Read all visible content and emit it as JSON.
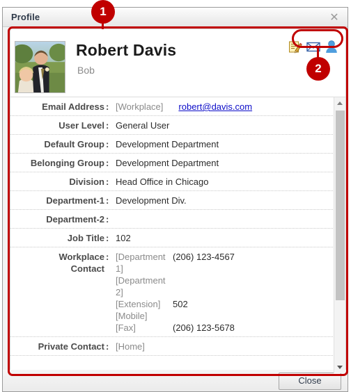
{
  "window": {
    "title": "Profile",
    "close_icon": "close-x-icon"
  },
  "header": {
    "name": "Robert Davis",
    "alias": "Bob",
    "photo_alt": "profile-photo",
    "actions": [
      {
        "name": "edit-profile-icon",
        "title": "Edit"
      },
      {
        "name": "send-mail-icon",
        "title": "Mail"
      },
      {
        "name": "user-icon",
        "title": "User"
      }
    ]
  },
  "details": [
    {
      "label": "Email Address",
      "type": "email",
      "tag": "[Workplace]",
      "value": "robert@davis.com"
    },
    {
      "label": "User Level",
      "type": "text",
      "value": "General User"
    },
    {
      "label": "Default Group",
      "type": "text",
      "value": "Development Department"
    },
    {
      "label": "Belonging Group",
      "type": "text",
      "value": "Development Department"
    },
    {
      "label": "Division",
      "type": "text",
      "value": "Head Office in Chicago"
    },
    {
      "label": "Department-1",
      "type": "text",
      "value": "Development Div."
    },
    {
      "label": "Department-2",
      "type": "text",
      "value": ""
    },
    {
      "label": "Job Title",
      "type": "text",
      "value": "102"
    },
    {
      "label": "Workplace\nContact",
      "type": "pairs",
      "pairs": [
        {
          "key": "[Department 1]",
          "value": "(206) 123-4567"
        },
        {
          "key": "[Department 2]",
          "value": ""
        },
        {
          "key": "[Extension]",
          "value": "502"
        },
        {
          "key": "[Mobile]",
          "value": ""
        },
        {
          "key": "[Fax]",
          "value": "(206) 123-5678"
        }
      ]
    },
    {
      "label": "Private Contact",
      "type": "pairs",
      "pairs": [
        {
          "key": "[Home]",
          "value": ""
        }
      ]
    }
  ],
  "scrollbar": {
    "up_icon": "scroll-up-arrow-icon",
    "down_icon": "scroll-down-arrow-icon"
  },
  "footer": {
    "close_label": "Close"
  },
  "callouts": [
    {
      "number": "1"
    },
    {
      "number": "2"
    }
  ],
  "colors": {
    "annotation_red": "#c00000",
    "link_blue": "#0b0bc8",
    "label_gray": "#4b4b4b"
  }
}
